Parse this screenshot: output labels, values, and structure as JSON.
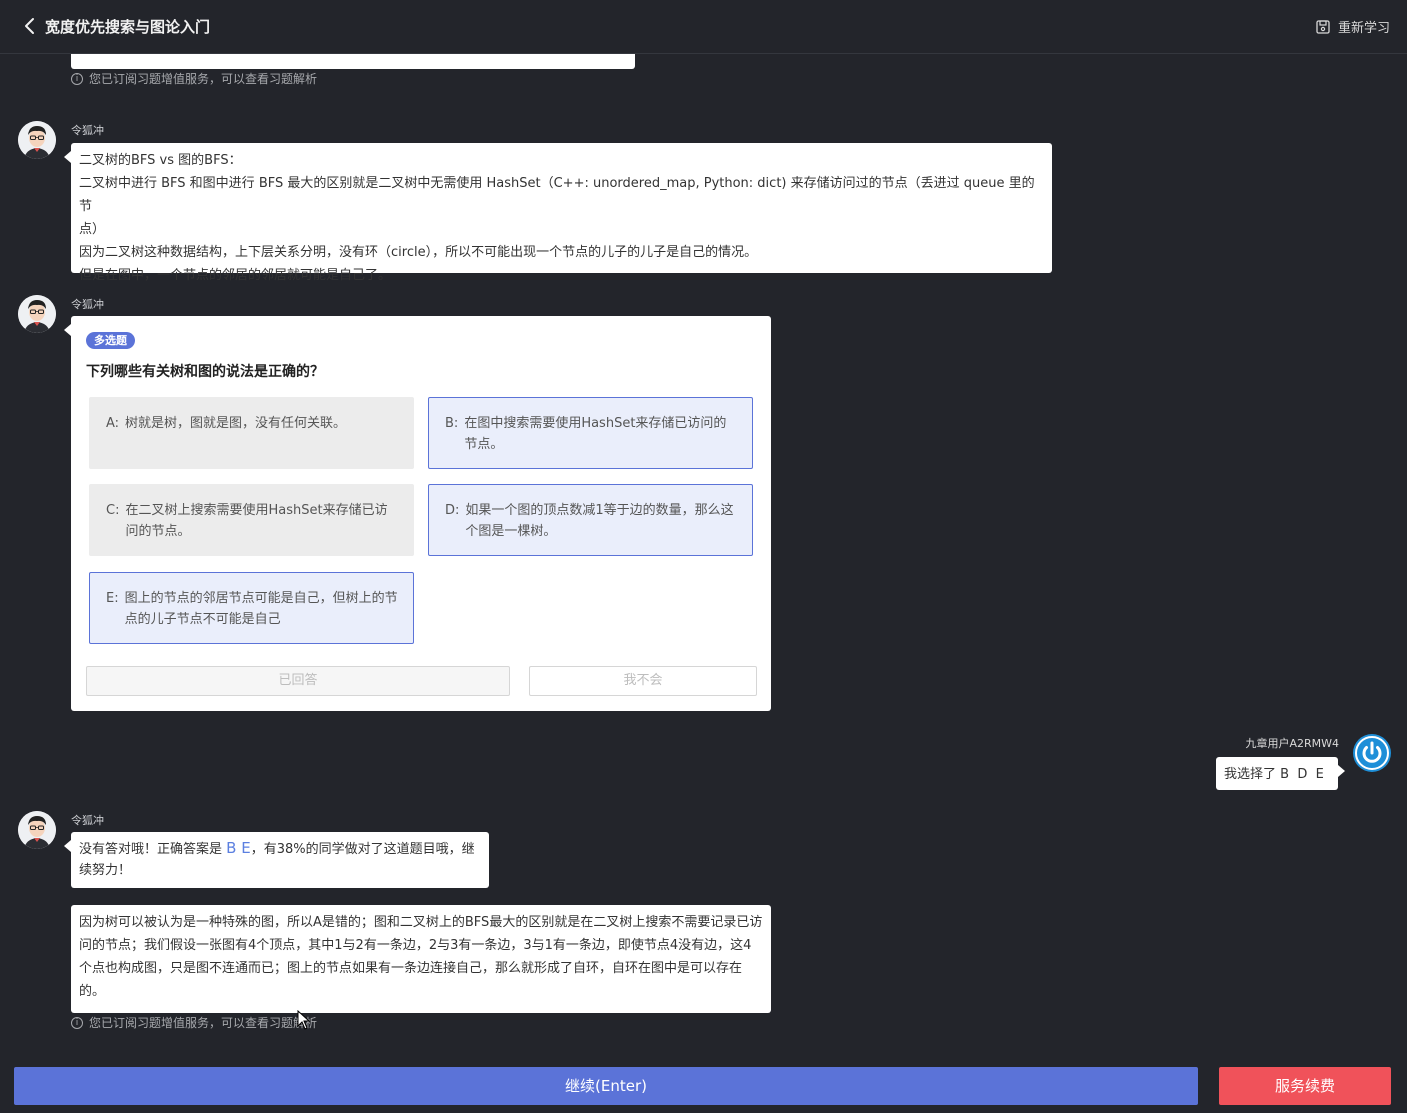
{
  "header": {
    "title": "宽度优先搜索与图论入门",
    "restart_label": "重新学习"
  },
  "notice_text": "您已订阅习题增值服务，可以查看习题解析",
  "notice_icon": "ⓘ",
  "messages": {
    "bot_name": "令狐冲",
    "msg1": {
      "lines": [
        "二叉树的BFS vs 图的BFS：",
        "二叉树中进行 BFS 和图中进行 BFS 最大的区别就是二叉树中无需使用 HashSet（C++: unordered_map, Python: dict) 来存储访问过的节点（丢进过 queue 里的节",
        "点）",
        "因为二叉树这种数据结构，上下层关系分明，没有环（circle），所以不可能出现一个节点的儿子的儿子是自己的情况。",
        "但是在图中，一个节点的邻居的邻居就可能是自己了。"
      ]
    },
    "quiz": {
      "tag": "多选题",
      "question": "下列哪些有关树和图的说法是正确的？",
      "options": [
        {
          "key": "A:",
          "text": "树就是树，图就是图，没有任何关联。",
          "selected": false
        },
        {
          "key": "B:",
          "text": "在图中搜索需要使用HashSet来存储已访问的节点。",
          "selected": true
        },
        {
          "key": "C:",
          "text": "在二叉树上搜索需要使用HashSet来存储已访问的节点。",
          "selected": false
        },
        {
          "key": "D:",
          "text": "如果一个图的顶点数减1等于边的数量，那么这个图是一棵树。",
          "selected": true
        },
        {
          "key": "E:",
          "text": "图上的节点的邻居节点可能是自己，但树上的节点的儿子节点不可能是自己",
          "selected": true
        }
      ],
      "answered_label": "已回答",
      "dont_know_label": "我不会"
    },
    "user": {
      "name": "九章用户A2RMW4",
      "reply": "我选择了 B  D  E"
    },
    "feedback": {
      "prefix": "没有答对哦！正确答案是 ",
      "answer": "B E",
      "suffix": "，有38%的同学做对了这道题目哦，继续努力！"
    },
    "explanation": "因为树可以被认为是一种特殊的图，所以A是错的；图和二叉树上的BFS最大的区别就是在二叉树上搜索不需要记录已访问的节点；我们假设一张图有4个顶点，其中1与2有一条边，2与3有一条边，3与1有一条边，即使节点4没有边，这4个点也构成图，只是图不连通而已；图上的节点如果有一条边连接自己，那么就形成了自环，自环在图中是可以存在的。"
  },
  "footer": {
    "continue_label": "继续(Enter)",
    "renew_label": "服务续费"
  },
  "colors": {
    "background": "#23252b",
    "accent": "#5b73d8",
    "danger": "#f0525a"
  }
}
